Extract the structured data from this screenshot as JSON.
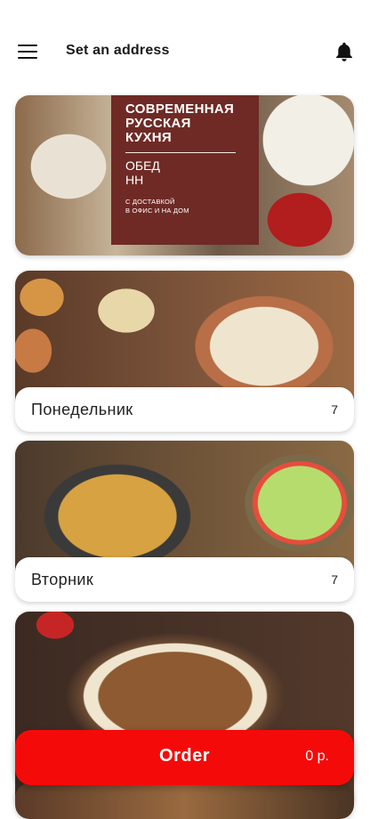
{
  "header": {
    "address_label": "Set an address",
    "menu_icon": "hamburger-menu-icon",
    "notification_icon": "bell-icon"
  },
  "banner": {
    "title_lines": [
      "СОВРЕМЕННАЯ",
      "РУССКАЯ",
      "КУХНЯ"
    ],
    "subtitle_lines": [
      "ОБЕД",
      "НН"
    ],
    "note_lines": [
      "С ДОСТАВКОЙ",
      "В ОФИС И НА ДОМ"
    ],
    "panel_color": "#6f2a25"
  },
  "days": [
    {
      "name": "Понедельник",
      "count": "7"
    },
    {
      "name": "Вторник",
      "count": "7"
    }
  ],
  "order": {
    "label": "Order",
    "price": "0 р.",
    "color": "#f50a0a"
  }
}
